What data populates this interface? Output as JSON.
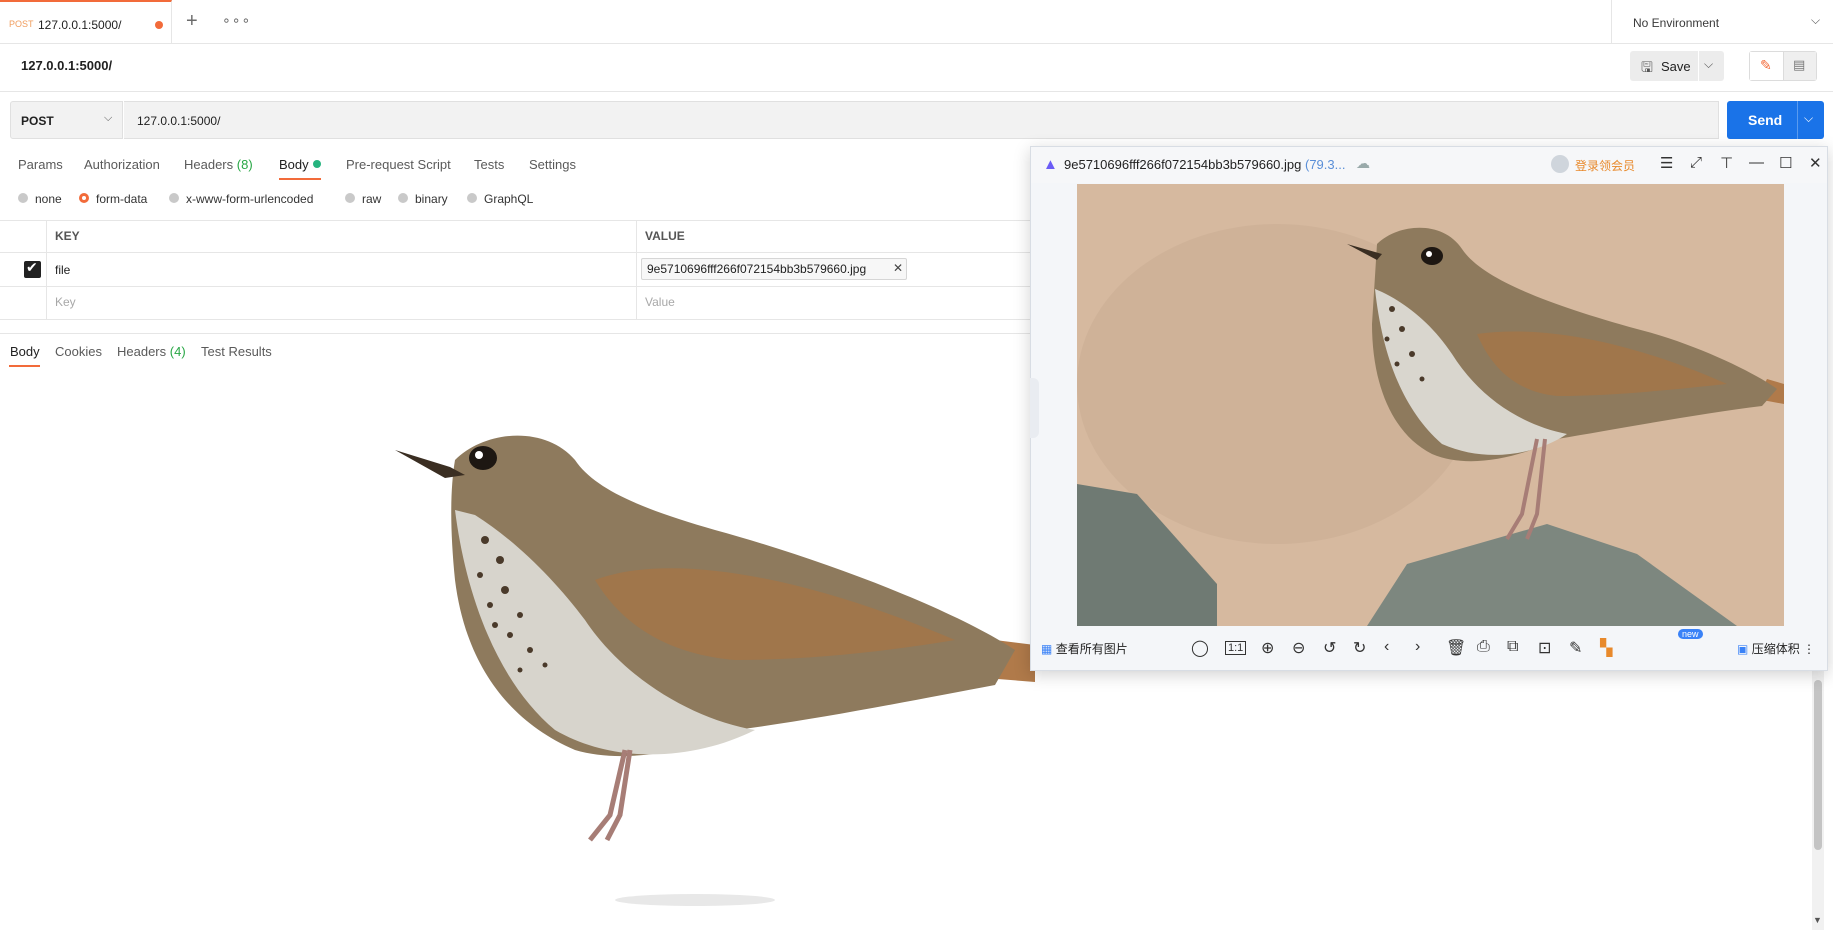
{
  "tab": {
    "method": "POST",
    "title": "127.0.0.1:5000/",
    "more": "∘∘∘"
  },
  "environment": {
    "label": "No Environment"
  },
  "request": {
    "title": "127.0.0.1:5000/",
    "save_label": "Save",
    "method": "POST",
    "url": "127.0.0.1:5000/",
    "send_label": "Send"
  },
  "request_tabs": [
    {
      "label": "Params"
    },
    {
      "label": "Authorization"
    },
    {
      "label": "Headers",
      "count": "(8)"
    },
    {
      "label": "Body"
    },
    {
      "label": "Pre-request Script"
    },
    {
      "label": "Tests"
    },
    {
      "label": "Settings"
    }
  ],
  "body_types": [
    {
      "label": "none",
      "selected": false
    },
    {
      "label": "form-data",
      "selected": true
    },
    {
      "label": "x-www-form-urlencoded",
      "selected": false
    },
    {
      "label": "raw",
      "selected": false
    },
    {
      "label": "binary",
      "selected": false
    },
    {
      "label": "GraphQL",
      "selected": false
    }
  ],
  "form_table": {
    "headers": [
      "KEY",
      "VALUE"
    ],
    "rows": [
      {
        "checked": true,
        "key": "file",
        "value": "9e5710696fff266f072154bb3b579660.jpg"
      }
    ],
    "placeholder": {
      "key": "Key",
      "value": "Value"
    }
  },
  "response_tabs": [
    {
      "label": "Body"
    },
    {
      "label": "Cookies"
    },
    {
      "label": "Headers",
      "count": "(4)"
    },
    {
      "label": "Test Results"
    }
  ],
  "viewer": {
    "filename": "9e5710696fff266f072154bb3b579660.jpg",
    "filesize": "(79.3...",
    "vip_label": "登录领会员",
    "view_all_label": "查看所有图片",
    "one_to_one": "1:1",
    "new_badge": "new",
    "compress_label": "压缩体积"
  },
  "colors": {
    "accent": "#f26b3a",
    "send": "#1a73e8",
    "count": "#28a745"
  }
}
